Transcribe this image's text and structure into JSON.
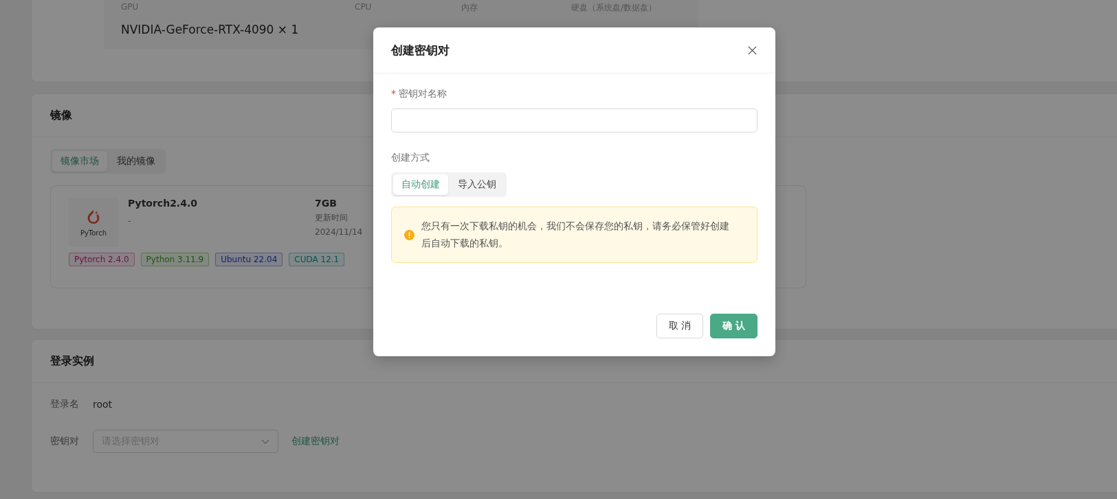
{
  "spec_table": {
    "columns": [
      "GPU",
      "CPU",
      "内存",
      "硬盘（系统盘/数据盘）"
    ],
    "values": [
      "NVIDIA-GeForce-RTX-4090 × 1"
    ]
  },
  "image_section": {
    "title": "镜像",
    "tabs": [
      {
        "label": "镜像市场",
        "selected": true
      },
      {
        "label": "我的镜像",
        "selected": false
      }
    ],
    "image_card": {
      "logo_text": "PyTorch",
      "name": "Pytorch2.4.0",
      "description": "-",
      "size": "7GB",
      "updated_label": "更新时间",
      "updated": "2024/11/14",
      "tags": [
        {
          "label": "Pytorch 2.4.0",
          "color": "#6c1046"
        },
        {
          "label": "Python 3.11.9",
          "color": "#1f5707"
        },
        {
          "label": "Ubuntu 22.04",
          "color": "#101f6c"
        },
        {
          "label": "CUDA 12.1",
          "color": "#045356"
        }
      ]
    }
  },
  "login_section": {
    "title": "登录实例",
    "login_name_label": "登录名",
    "login_name": "root",
    "keypair_label": "密钥对",
    "keypair_select": {
      "placeholder": "请选择密钥对"
    },
    "create_link": "创建密钥对"
  },
  "dialog": {
    "title": "创建密钥对",
    "name_field": {
      "required_mark": "*",
      "label": "密钥对名称"
    },
    "method_label": "创建方式",
    "methods": [
      {
        "label": "自动创建",
        "selected": true
      },
      {
        "label": "导入公钥",
        "selected": false
      }
    ],
    "alert": "您只有一次下载私钥的机会，我们不会保存您的私钥，请务必保管好创建后自动下载的私钥。",
    "buttons": [
      {
        "label": "取 消",
        "kind": "default"
      },
      {
        "label": "确 认",
        "kind": "primary"
      }
    ]
  }
}
